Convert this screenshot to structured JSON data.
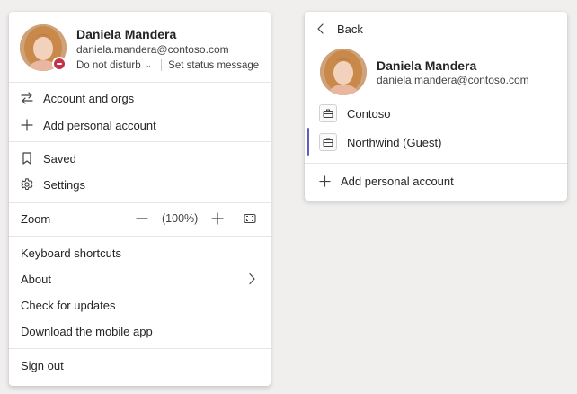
{
  "menu": {
    "profile": {
      "name": "Daniela Mandera",
      "email": "daniela.mandera@contoso.com",
      "status": "Do not disturb",
      "set_status": "Set status message"
    },
    "items_top": [
      {
        "label": "Account and orgs",
        "icon": "switch-arrows-icon"
      },
      {
        "label": "Add personal account",
        "icon": "plus-icon"
      }
    ],
    "items_mid": [
      {
        "label": "Saved",
        "icon": "bookmark-icon"
      },
      {
        "label": "Settings",
        "icon": "gear-icon"
      }
    ],
    "zoom": {
      "label": "Zoom",
      "value": "(100%)"
    },
    "items_bottom": [
      {
        "label": "Keyboard shortcuts"
      },
      {
        "label": "About"
      },
      {
        "label": "Check for updates"
      },
      {
        "label": "Download the mobile app"
      }
    ],
    "sign_out": "Sign out"
  },
  "accounts": {
    "back": "Back",
    "profile": {
      "name": "Daniela Mandera",
      "email": "daniela.mandera@contoso.com"
    },
    "orgs": [
      {
        "label": "Contoso",
        "icon": "briefcase-icon"
      },
      {
        "label": "Northwind (Guest)",
        "icon": "briefcase-icon",
        "active": true
      }
    ],
    "add_account": "Add personal account"
  },
  "colors": {
    "accent": "#5b5fc7",
    "dnd_status": "#c4314b",
    "background": "#f0efee"
  }
}
